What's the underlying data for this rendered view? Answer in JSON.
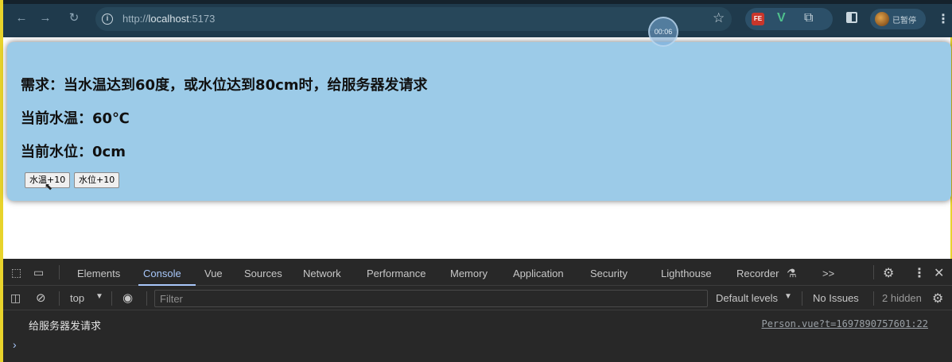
{
  "browser": {
    "url_prefix": "http://",
    "url_host": "localhost",
    "url_port": ":5173",
    "timer_text": "00:06",
    "profile_label": "已暂停",
    "ext_fe_label": "FE",
    "ext_v_label": "V"
  },
  "page": {
    "requirement": "需求：当水温达到60度，或水位达到80cm时，给服务器发请求",
    "temp_line": "当前水温：60℃",
    "level_line": "当前水位：0cm",
    "btn_temp": "水温+10",
    "btn_level": "水位+10"
  },
  "devtools": {
    "tabs": [
      "Elements",
      "Console",
      "Vue",
      "Sources",
      "Network",
      "Performance",
      "Memory",
      "Application",
      "Security",
      "Lighthouse",
      "Recorder"
    ],
    "active_tab": "Console",
    "more_tabs": ">>",
    "context": "top",
    "filter_placeholder": "Filter",
    "levels": "Default levels",
    "issues": "No Issues",
    "hidden": "2 hidden",
    "log_message": "给服务器发请求",
    "log_source": "Person.vue?t=1697890757601:22"
  }
}
